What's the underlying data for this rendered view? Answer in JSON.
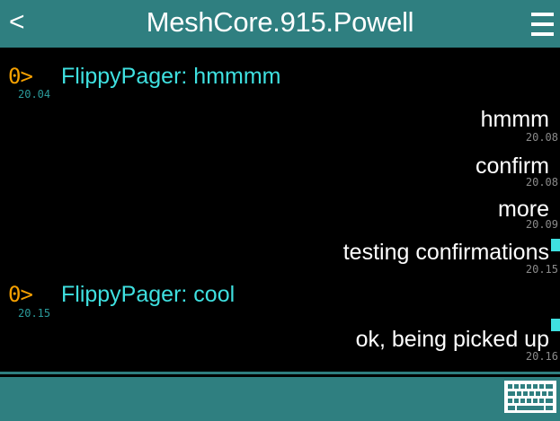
{
  "header": {
    "back_label": "<",
    "title": "MeshCore.915.Powell",
    "menu_icon": "hamburger-menu-icon"
  },
  "messages": [
    {
      "direction": "in",
      "prefix": "0>",
      "text": "FlippyPager: hmmmm",
      "time": "20.04"
    },
    {
      "direction": "out",
      "text": "hmmm",
      "time": "20.08",
      "ack": false
    },
    {
      "direction": "out",
      "text": "confirm",
      "time": "20.08",
      "ack": false
    },
    {
      "direction": "out",
      "text": "more",
      "time": "20.09",
      "ack": false
    },
    {
      "direction": "out",
      "text": "testing confirmations",
      "time": "20.15",
      "ack": true
    },
    {
      "direction": "in",
      "prefix": "0>",
      "text": "FlippyPager: cool",
      "time": "20.15"
    },
    {
      "direction": "out",
      "text": "ok, being picked up",
      "time": "20.16",
      "ack": true
    }
  ],
  "footer": {
    "keyboard_icon": "keyboard-icon"
  },
  "colors": {
    "accent": "#2f7f80",
    "incoming_prefix": "#f5a000",
    "incoming_text": "#3fe0e0",
    "outgoing_text": "#ffffff",
    "timestamp": "#8a8a8a"
  }
}
